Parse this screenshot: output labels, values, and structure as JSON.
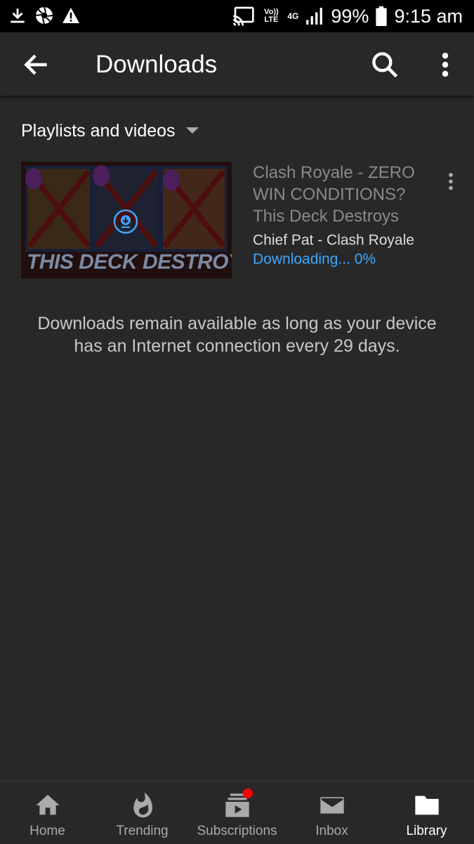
{
  "status_bar": {
    "volte": "Vo)) LTE",
    "network": "4G",
    "battery": "99%",
    "time": "9:15 am"
  },
  "app_bar": {
    "title": "Downloads",
    "icons": [
      "back-arrow-icon",
      "search-icon",
      "more-vert-icon"
    ]
  },
  "filter": {
    "label": "Playlists and videos"
  },
  "video": {
    "title": "Clash Royale - ZERO WIN CONDITIONS? This Deck Destroys",
    "channel": "Chief Pat - Clash Royale",
    "status": "Downloading... 0%",
    "thumbnail_text": "THIS DECK DESTROYS",
    "progress": 0
  },
  "note": "Downloads remain available as long as your device has an Internet connection every 29 days.",
  "bottom_nav": {
    "items": [
      {
        "label": "Home",
        "icon": "home-icon",
        "active": false
      },
      {
        "label": "Trending",
        "icon": "flame-icon",
        "active": false
      },
      {
        "label": "Subscriptions",
        "icon": "subscriptions-icon",
        "active": false,
        "badge": true
      },
      {
        "label": "Inbox",
        "icon": "mail-icon",
        "active": false
      },
      {
        "label": "Library",
        "icon": "folder-icon",
        "active": true
      }
    ]
  },
  "colors": {
    "background": "#282828",
    "accent_blue": "#3ea6ff",
    "badge_red": "#ff0000"
  }
}
